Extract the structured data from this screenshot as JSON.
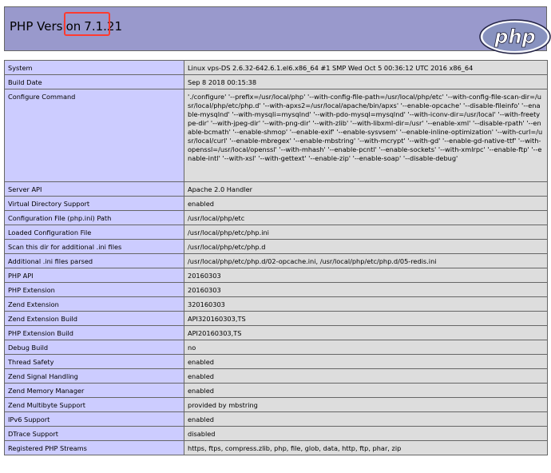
{
  "header": {
    "title_prefix": "PHP Version",
    "version": "7.1.21",
    "logo_text": "php"
  },
  "rows": [
    {
      "key": "System",
      "value": "Linux vps-DS 2.6.32-642.6.1.el6.x86_64 #1 SMP Wed Oct 5 00:36:12 UTC 2016 x86_64"
    },
    {
      "key": "Build Date",
      "value": "Sep 8 2018 00:15:38"
    },
    {
      "key": "Configure Command",
      "value": "'./configure' '--prefix=/usr/local/php' '--with-config-file-path=/usr/local/php/etc' '--with-config-file-scan-dir=/usr/local/php/etc/php.d' '--with-apxs2=/usr/local/apache/bin/apxs' '--enable-opcache' '--disable-fileinfo' '--enable-mysqlnd' '--with-mysqli=mysqlnd' '--with-pdo-mysql=mysqlnd' '--with-iconv-dir=/usr/local' '--with-freetype-dir' '--with-jpeg-dir' '--with-png-dir' '--with-zlib' '--with-libxml-dir=/usr' '--enable-xml' '--disable-rpath' '--enable-bcmath' '--enable-shmop' '--enable-exif' '--enable-sysvsem' '--enable-inline-optimization' '--with-curl=/usr/local/curl' '--enable-mbregex' '--enable-mbstring' '--with-mcrypt' '--with-gd' '--enable-gd-native-ttf' '--with-openssl=/usr/local/openssl' '--with-mhash' '--enable-pcntl' '--enable-sockets' '--with-xmlrpc' '--enable-ftp' '--enable-intl' '--with-xsl' '--with-gettext' '--enable-zip' '--enable-soap' '--disable-debug'"
    },
    {
      "key": "Server API",
      "value": "Apache 2.0 Handler"
    },
    {
      "key": "Virtual Directory Support",
      "value": "enabled"
    },
    {
      "key": "Configuration File (php.ini) Path",
      "value": "/usr/local/php/etc"
    },
    {
      "key": "Loaded Configuration File",
      "value": "/usr/local/php/etc/php.ini"
    },
    {
      "key": "Scan this dir for additional .ini files",
      "value": "/usr/local/php/etc/php.d"
    },
    {
      "key": "Additional .ini files parsed",
      "value": "/usr/local/php/etc/php.d/02-opcache.ini, /usr/local/php/etc/php.d/05-redis.ini"
    },
    {
      "key": "PHP API",
      "value": "20160303"
    },
    {
      "key": "PHP Extension",
      "value": "20160303"
    },
    {
      "key": "Zend Extension",
      "value": "320160303"
    },
    {
      "key": "Zend Extension Build",
      "value": "API320160303,TS"
    },
    {
      "key": "PHP Extension Build",
      "value": "API20160303,TS"
    },
    {
      "key": "Debug Build",
      "value": "no"
    },
    {
      "key": "Thread Safety",
      "value": "enabled"
    },
    {
      "key": "Zend Signal Handling",
      "value": "enabled"
    },
    {
      "key": "Zend Memory Manager",
      "value": "enabled"
    },
    {
      "key": "Zend Multibyte Support",
      "value": "provided by mbstring"
    },
    {
      "key": "IPv6 Support",
      "value": "enabled"
    },
    {
      "key": "DTrace Support",
      "value": "disabled"
    },
    {
      "key": "Registered PHP Streams",
      "value": "https, ftps, compress.zlib, php, file, glob, data, http, ftp, phar, zip"
    }
  ],
  "colors": {
    "header_bg": "#9999cc",
    "key_bg": "#ccccff",
    "value_bg": "#dddddd",
    "highlight": "#ff3b30"
  }
}
